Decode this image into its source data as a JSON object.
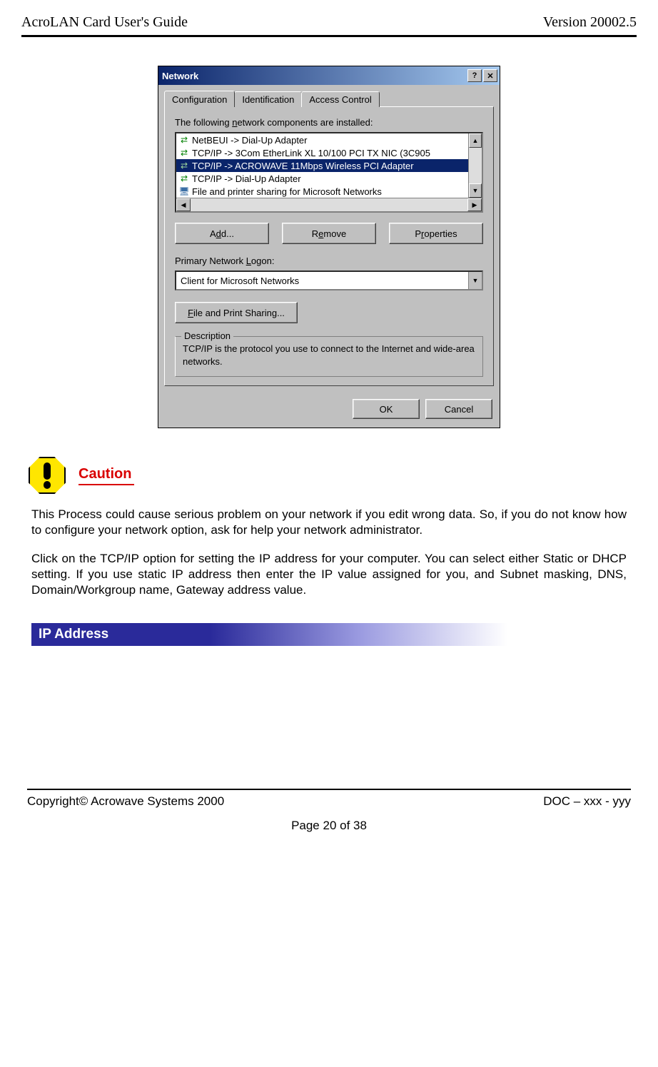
{
  "doc": {
    "header_left": "AcroLAN Card User's Guide",
    "header_right": "Version 20002.5",
    "footer_left": "Copyright© Acrowave Systems 2000",
    "footer_right": "DOC – xxx - yyy",
    "page_num": "Page 20 of 38"
  },
  "dialog": {
    "title": "Network",
    "tabs": [
      "Configuration",
      "Identification",
      "Access Control"
    ],
    "components_label_pre": "The following ",
    "components_label_u": "n",
    "components_label_post": "etwork components are installed:",
    "items": [
      "NetBEUI -> Dial-Up Adapter",
      "TCP/IP -> 3Com EtherLink XL 10/100 PCI TX NIC (3C905",
      "TCP/IP -> ACROWAVE 11Mbps Wireless PCI Adapter",
      "TCP/IP -> Dial-Up Adapter",
      "File and printer sharing for Microsoft Networks"
    ],
    "buttons": {
      "add_pre": "A",
      "add_u": "d",
      "add_post": "d...",
      "remove_pre": "R",
      "remove_u": "e",
      "remove_post": "move",
      "props_pre": "P",
      "props_u": "r",
      "props_post": "operties"
    },
    "logon_label_pre": "Primary Network ",
    "logon_label_u": "L",
    "logon_label_post": "ogon:",
    "logon_value": "Client for Microsoft Networks",
    "fps_pre": "",
    "fps_u": "F",
    "fps_post": "ile and Print Sharing...",
    "desc_legend": "Description",
    "desc_text": "TCP/IP is the protocol you use to connect to the Internet and wide-area networks.",
    "ok": "OK",
    "cancel": "Cancel"
  },
  "caution": {
    "label": "Caution"
  },
  "paras": {
    "p1": "This Process could cause serious problem on your network if you edit wrong data. So, if you do not know how to configure your network option, ask for help your network administrator.",
    "p2": "Click on the TCP/IP option for setting the IP address for your computer. You can select either Static or DHCP setting. If you use static IP address then enter the IP value assigned for you, and Subnet masking, DNS, Domain/Workgroup name, Gateway address value."
  },
  "section": {
    "ip": "IP Address"
  }
}
